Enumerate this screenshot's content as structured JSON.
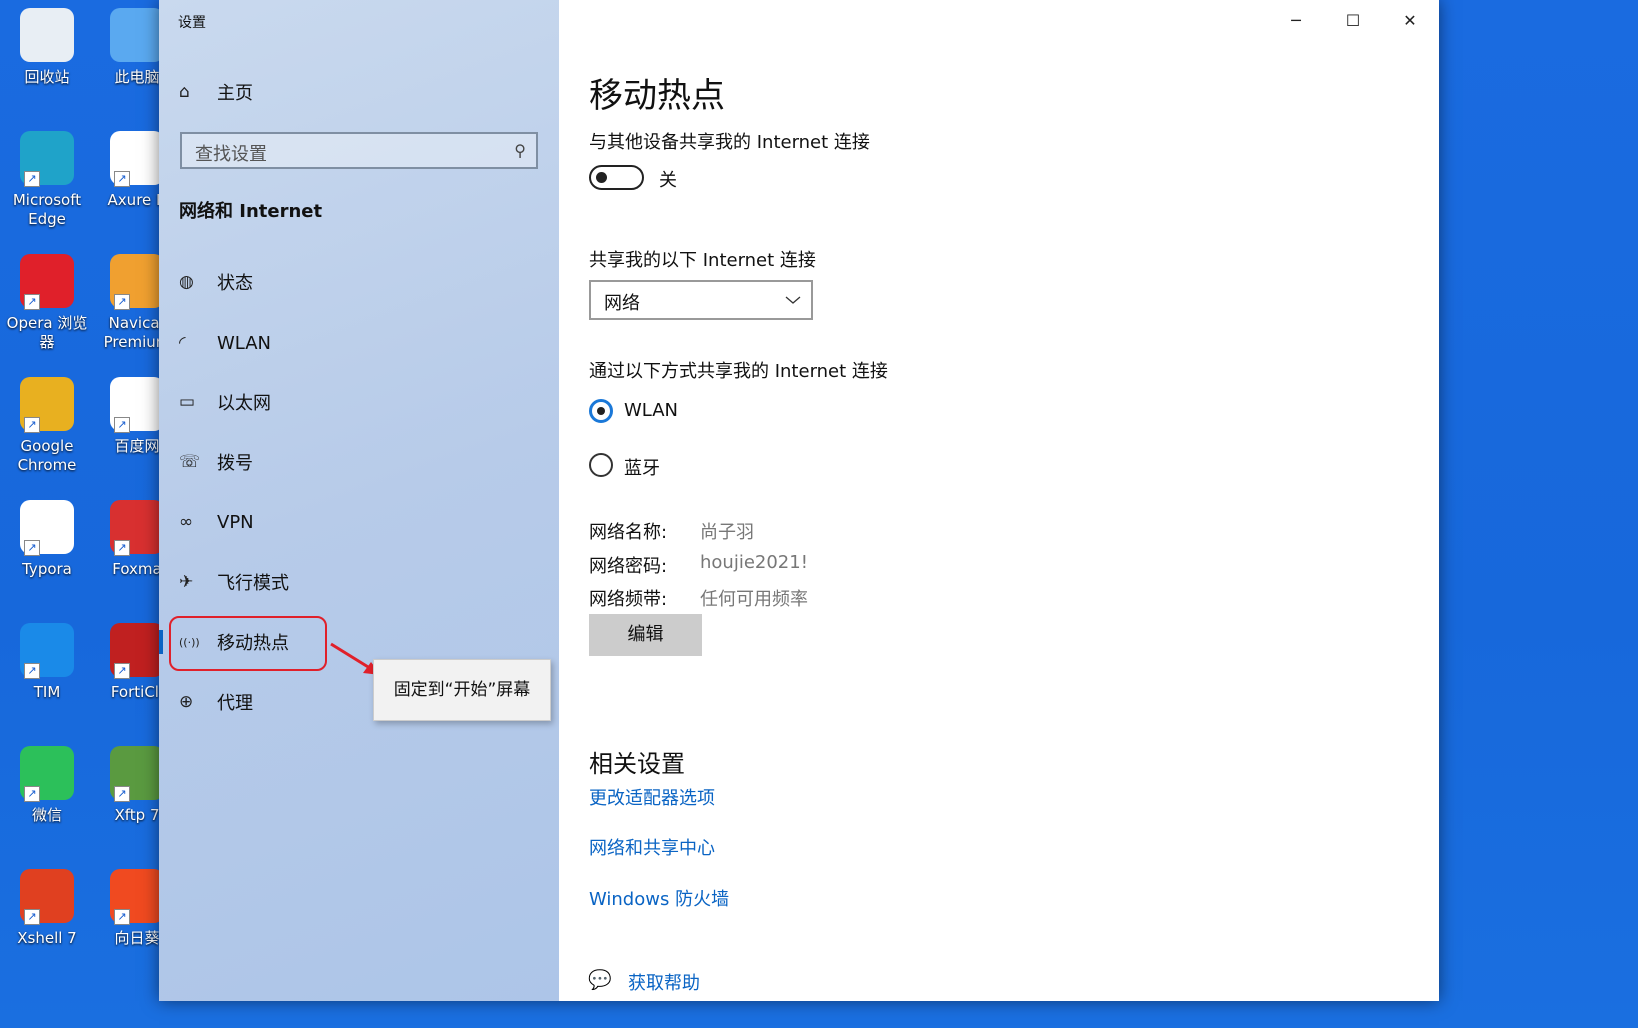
{
  "desktop": {
    "icons": [
      {
        "label": "回收站",
        "color": "#e8eef4"
      },
      {
        "label": "此电脑",
        "color": "#5aa9f0"
      },
      {
        "label": "Microsoft Edge",
        "color": "#1fa3c9"
      },
      {
        "label": "Axure R",
        "color": "#ffffff"
      },
      {
        "label": "Opera 浏览器",
        "color": "#e0202a"
      },
      {
        "label": "Navicat Premium",
        "color": "#f0a030"
      },
      {
        "label": "Google Chrome",
        "color": "#e8b020"
      },
      {
        "label": "百度网",
        "color": "#ffffff"
      },
      {
        "label": "Typora",
        "color": "#ffffff"
      },
      {
        "label": "Foxma",
        "color": "#d83030"
      },
      {
        "label": "TIM",
        "color": "#1a8ae8"
      },
      {
        "label": "FortiCli",
        "color": "#c02020"
      },
      {
        "label": "微信",
        "color": "#2cc05a"
      },
      {
        "label": "Xftp 7",
        "color": "#5a9a40"
      },
      {
        "label": "Xshell 7",
        "color": "#e04020"
      },
      {
        "label": "向日葵",
        "color": "#f04a20"
      }
    ]
  },
  "window": {
    "title": "设置",
    "minimize": "─",
    "maximize": "☐",
    "close": "✕"
  },
  "sidebar": {
    "home": "主页",
    "search_placeholder": "查找设置",
    "section": "网络和 Internet",
    "items": [
      {
        "label": "状态",
        "icon": "globe-status-icon",
        "glyph": "◍"
      },
      {
        "label": "WLAN",
        "icon": "wifi-icon",
        "glyph": "◜"
      },
      {
        "label": "以太网",
        "icon": "ethernet-icon",
        "glyph": "▭"
      },
      {
        "label": "拨号",
        "icon": "dialup-icon",
        "glyph": "☏"
      },
      {
        "label": "VPN",
        "icon": "vpn-icon",
        "glyph": "∞"
      },
      {
        "label": "飞行模式",
        "icon": "airplane-icon",
        "glyph": "✈"
      },
      {
        "label": "移动热点",
        "icon": "hotspot-icon",
        "glyph": "((·))",
        "selected": true
      },
      {
        "label": "代理",
        "icon": "proxy-globe-icon",
        "glyph": "⊕"
      }
    ],
    "tooltip": "固定到“开始”屏幕"
  },
  "main": {
    "title": "移动热点",
    "share_label": "与其他设备共享我的 Internet 连接",
    "toggle_state": "关",
    "toggle_on": false,
    "source_label": "共享我的以下 Internet 连接",
    "source_value": "网络",
    "via_label": "通过以下方式共享我的 Internet 连接",
    "via_options": [
      {
        "label": "WLAN",
        "checked": true
      },
      {
        "label": "蓝牙",
        "checked": false
      }
    ],
    "info": [
      {
        "label": "网络名称:",
        "value": "尚子羽"
      },
      {
        "label": "网络密码:",
        "value": "houjie2021!"
      },
      {
        "label": "网络频带:",
        "value": "任何可用频率"
      }
    ],
    "edit": "编辑",
    "related_title": "相关设置",
    "links": [
      "更改适配器选项",
      "网络和共享中心",
      "Windows 防火墙"
    ],
    "help": "获取帮助",
    "accent": "#0a64c4"
  }
}
